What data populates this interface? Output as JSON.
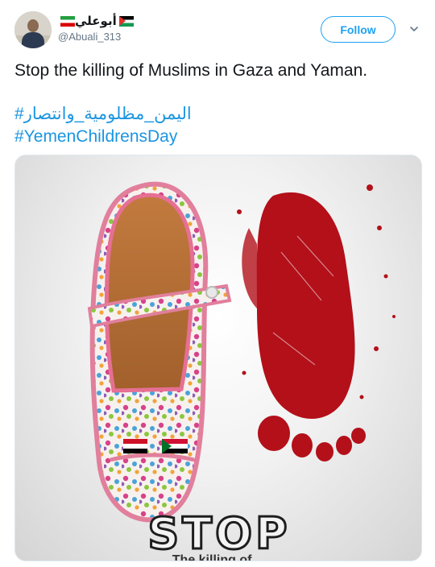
{
  "user": {
    "display_name": "أبوعلي",
    "handle": "@Abuali_313",
    "flags": [
      "iran-flag",
      "palestine-flag"
    ]
  },
  "actions": {
    "follow_label": "Follow",
    "menu_icon": "chevron-down-icon"
  },
  "tweet": {
    "text": "Stop the killing of Muslims in Gaza and Yaman.",
    "hashtag_ar": "#اليمن_مظلومية_وانتصار",
    "hashtag_en": "#YemenChildrensDay"
  },
  "media": {
    "stop_text": "STOP",
    "sub_text": "The killing of ..."
  },
  "colors": {
    "accent": "#1da1f2",
    "hashtag": "#1b95e0",
    "secondary_text": "#657786",
    "blood": "#b3101a"
  }
}
